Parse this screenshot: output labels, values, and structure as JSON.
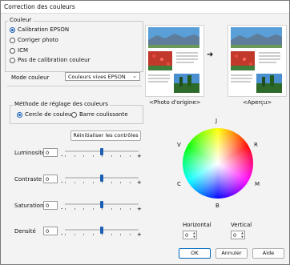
{
  "window": {
    "title": "Correction des couleurs"
  },
  "color_group": {
    "legend": "Couleur",
    "options": [
      {
        "label": "Calibration EPSON",
        "selected": true
      },
      {
        "label": "Corriger photo",
        "selected": false
      },
      {
        "label": "ICM",
        "selected": false
      },
      {
        "label": "Pas de calibration couleur",
        "selected": false
      }
    ]
  },
  "preview": {
    "original_caption": "<Photo d'origine>",
    "preview_caption": "<Aperçu>",
    "arrow_icon": "arrow-right-icon"
  },
  "color_mode": {
    "label": "Mode couleur",
    "value": "Couleurs vives EPSON"
  },
  "method_group": {
    "legend": "Méthode de réglage des couleurs",
    "options": [
      {
        "label": "Cercle de couleur",
        "selected": true
      },
      {
        "label": "Barre coulissante",
        "selected": false
      }
    ]
  },
  "reset_button": "Réinitialiser les contrôles",
  "sliders": [
    {
      "label": "Luminosité",
      "value": "0",
      "minus": "-",
      "plus": "+",
      "level": 0.5
    },
    {
      "label": "Contraste",
      "value": "0",
      "minus": "-",
      "plus": "+",
      "level": 0.5
    },
    {
      "label": "Saturation",
      "value": "0",
      "minus": "-",
      "plus": "+",
      "level": 0.5
    },
    {
      "label": "Densité",
      "value": "0",
      "minus": "-",
      "plus": "+",
      "level": 0.5
    }
  ],
  "wheel": {
    "labels": {
      "J": "J",
      "R": "R",
      "M": "M",
      "B": "B",
      "C": "C",
      "V": "V"
    }
  },
  "horizontal": {
    "label": "Horizontal",
    "value": "0"
  },
  "vertical": {
    "label": "Vertical",
    "value": "0"
  },
  "buttons": {
    "ok": "OK",
    "cancel": "Annuler",
    "help": "Aide"
  }
}
